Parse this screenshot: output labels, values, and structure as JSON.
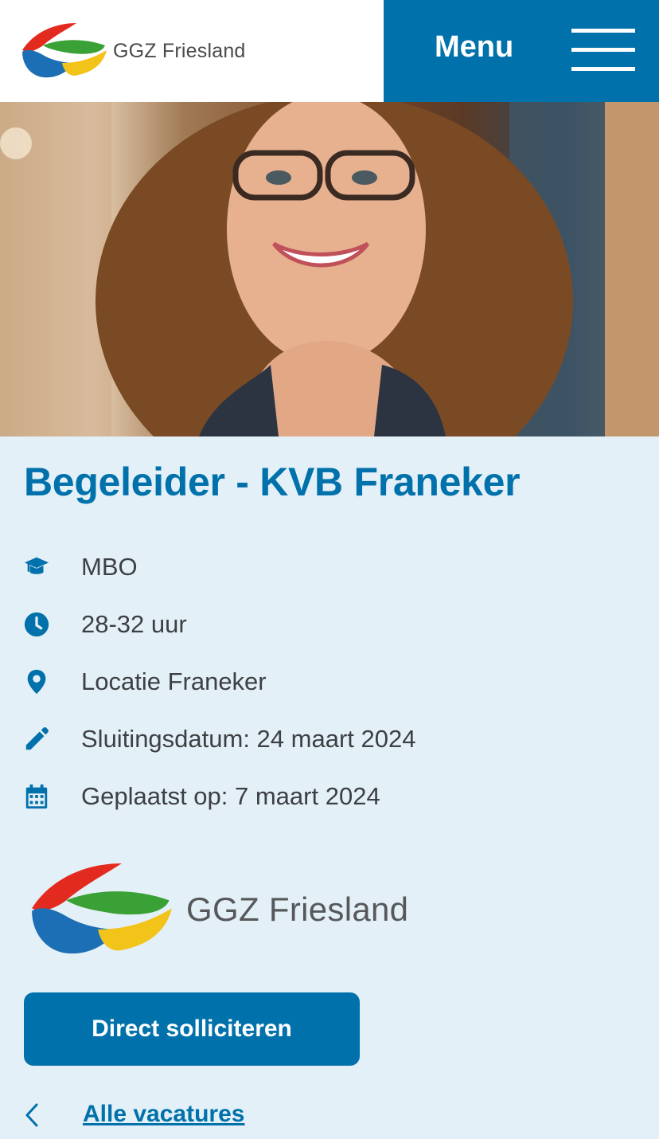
{
  "header": {
    "logo_text": "GGZ Friesland",
    "menu_label": "Menu"
  },
  "job": {
    "title": "Begeleider - KVB Franeker",
    "details": [
      {
        "icon": "graduation-cap-icon",
        "text": "MBO"
      },
      {
        "icon": "clock-icon",
        "text": "28-32 uur"
      },
      {
        "icon": "location-pin-icon",
        "text": "Locatie Franeker"
      },
      {
        "icon": "pencil-icon",
        "text": "Sluitingsdatum: 24 maart 2024"
      },
      {
        "icon": "calendar-icon",
        "text": "Geplaatst op: 7 maart 2024"
      }
    ]
  },
  "company_logo": {
    "text": "GGZ Friesland"
  },
  "actions": {
    "apply_label": "Direct solliciteren",
    "back_label": "Alle vacatures"
  },
  "colors": {
    "brand_blue": "#0071ab",
    "background": "#e4f0f7",
    "text": "#3c3f44"
  }
}
